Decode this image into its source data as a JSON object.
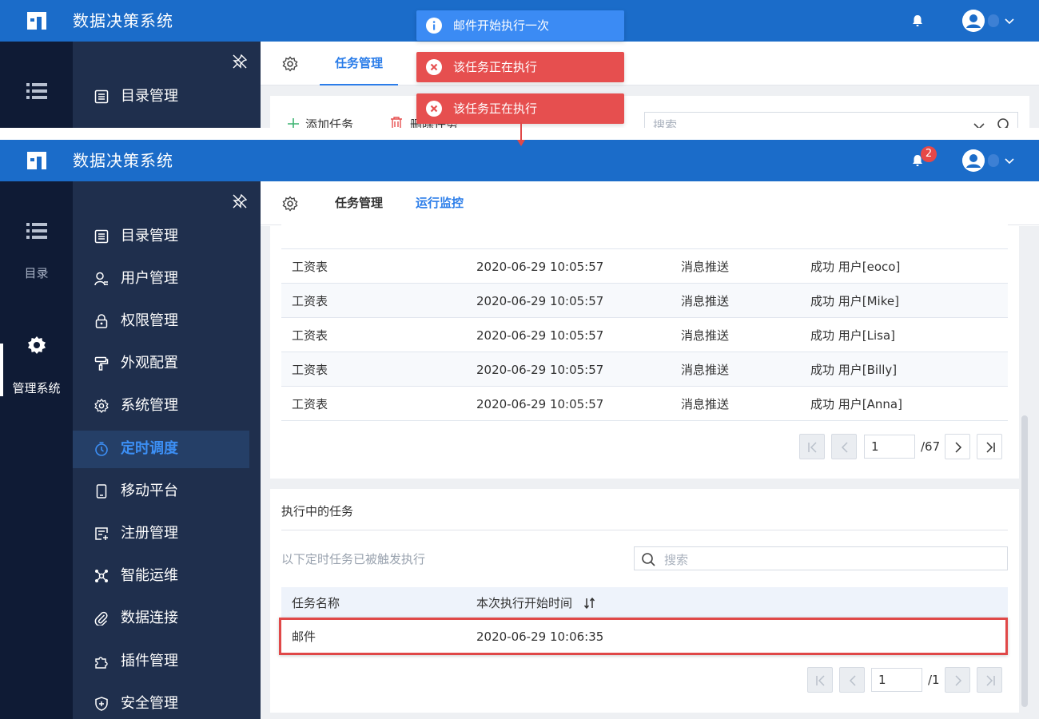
{
  "app": {
    "title": "数据决策系统"
  },
  "header": {
    "notification_count": "2"
  },
  "rail": {
    "catalog_label": "目录",
    "admin_label": "管理系统"
  },
  "sidebar": {
    "items": [
      {
        "label": "目录管理",
        "icon": "catalog-icon"
      },
      {
        "label": "用户管理",
        "icon": "user-icon"
      },
      {
        "label": "权限管理",
        "icon": "lock-icon"
      },
      {
        "label": "外观配置",
        "icon": "paint-brush-icon"
      },
      {
        "label": "系统管理",
        "icon": "gear-icon"
      },
      {
        "label": "定时调度",
        "icon": "timer-icon"
      },
      {
        "label": "移动平台",
        "icon": "mobile-icon"
      },
      {
        "label": "注册管理",
        "icon": "register-icon"
      },
      {
        "label": "智能运维",
        "icon": "network-icon"
      },
      {
        "label": "数据连接",
        "icon": "paperclip-icon"
      },
      {
        "label": "插件管理",
        "icon": "puzzle-icon"
      },
      {
        "label": "安全管理",
        "icon": "shield-icon"
      }
    ],
    "active_index": 5
  },
  "tabs": {
    "task_manage": "任务管理",
    "run_monitor": "运行监控"
  },
  "top_toolbar": {
    "add_task": "添加任务",
    "delete_task": "删除任务",
    "search_placeholder": "搜索"
  },
  "toasts": [
    {
      "type": "info",
      "text": "邮件开始执行一次"
    },
    {
      "type": "error",
      "text": "该任务正在执行"
    },
    {
      "type": "error",
      "text": "该任务正在执行"
    }
  ],
  "history": {
    "rows": [
      {
        "name": "工资表",
        "time": "2020-06-29 10:05:57",
        "type": "消息推送",
        "result": "成功  用户[eoco]"
      },
      {
        "name": "工资表",
        "time": "2020-06-29 10:05:57",
        "type": "消息推送",
        "result": "成功  用户[Mike]"
      },
      {
        "name": "工资表",
        "time": "2020-06-29 10:05:57",
        "type": "消息推送",
        "result": "成功  用户[Lisa]"
      },
      {
        "name": "工资表",
        "time": "2020-06-29 10:05:57",
        "type": "消息推送",
        "result": "成功  用户[Billy]"
      },
      {
        "name": "工资表",
        "time": "2020-06-29 10:05:57",
        "type": "消息推送",
        "result": "成功  用户[Anna]"
      }
    ],
    "pager": {
      "page": "1",
      "total": "/67"
    }
  },
  "running": {
    "title": "执行中的任务",
    "subtitle": "以下定时任务已被触发执行",
    "search_placeholder": "搜索",
    "col_name": "任务名称",
    "col_start": "本次执行开始时间",
    "rows": [
      {
        "name": "邮件",
        "start": "2020-06-29 10:06:35"
      }
    ],
    "pager": {
      "page": "1",
      "total": "/1"
    }
  },
  "colors": {
    "header": "#1b6cc9",
    "rail": "#0f1b35",
    "sidebar": "#1f2f4d",
    "accent": "#2b7de9",
    "error": "#e64f4f",
    "info": "#3b8bf4"
  }
}
